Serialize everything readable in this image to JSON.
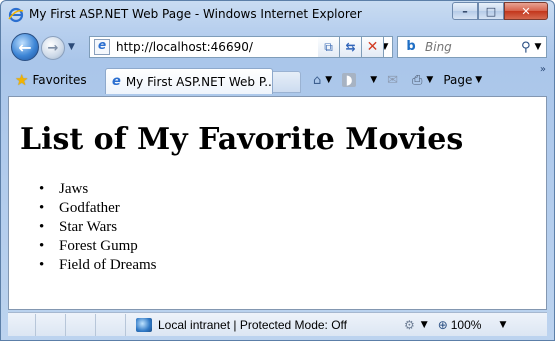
{
  "window": {
    "title": "My First ASP.NET Web Page - Windows Internet Explorer"
  },
  "caption": {
    "minimize": "–",
    "maximize": "□",
    "close": "✕"
  },
  "nav": {
    "back_icon": "back-arrow-icon",
    "forward_icon": "forward-arrow-icon",
    "address": "http://localhost:46690/",
    "search_placeholder": "Bing"
  },
  "favorites": {
    "label": "Favorites"
  },
  "tab": {
    "label": "My First ASP.NET Web P..."
  },
  "command_bar": {
    "page_label": "Page"
  },
  "page": {
    "heading": "List of My Favorite Movies",
    "movies": [
      "Jaws",
      "Godfather",
      "Star Wars",
      "Forest Gump",
      "Field of Dreams"
    ]
  },
  "status": {
    "zone": "Local intranet | Protected Mode: Off",
    "zoom": "100%"
  },
  "colors": {
    "frame": "#b7cfee",
    "close_button": "#c3361c"
  }
}
